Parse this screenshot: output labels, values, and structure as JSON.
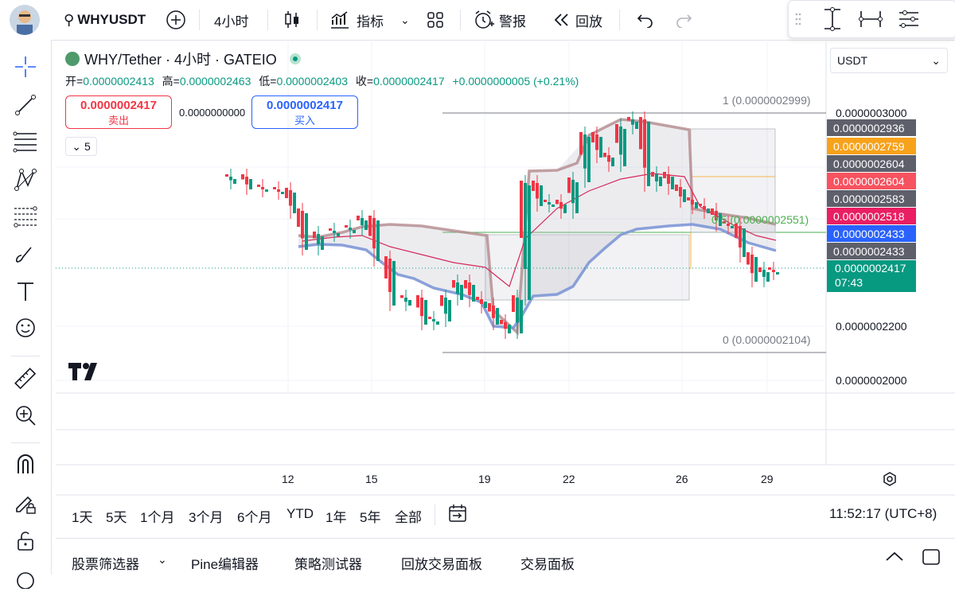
{
  "topbar": {
    "symbol": "WHYUSDT",
    "interval": "4小时",
    "indicators_label": "指标",
    "alert_label": "警报",
    "replay_label": "回放"
  },
  "legend": {
    "title": "WHY/Tether · 4小时 · GATEIO",
    "open_label": "开=",
    "open": "0.0000002413",
    "high_label": "高=",
    "high": "0.0000002463",
    "low_label": "低=",
    "low": "0.0000002403",
    "close_label": "收=",
    "close": "0.0000002417",
    "change": "+0.0000000005 (+0.21%)",
    "sell_price": "0.0000002417",
    "sell_label": "卖出",
    "spread": "0.0000000000",
    "buy_price": "0.0000002417",
    "buy_label": "买入",
    "collapse_count": "5"
  },
  "currency_select": "USDT",
  "fib": {
    "level_1": "1 (0.0000002999)",
    "level_05": "0.5 (0.0000002551)",
    "level_0": "0 (0.0000002104)"
  },
  "price_axis": {
    "ticks": [
      "0.0000003000",
      "0.0000002200",
      "0.0000002000"
    ],
    "tags": [
      {
        "value": "0.0000002936",
        "color": "#5d606b"
      },
      {
        "value": "0.0000002759",
        "color": "#f7a21b"
      },
      {
        "value": "0.0000002604",
        "color": "#5d606b"
      },
      {
        "value": "0.0000002604",
        "color": "#f7525f"
      },
      {
        "value": "0.0000002583",
        "color": "#5d606b"
      },
      {
        "value": "0.0000002518",
        "color": "#e91e63"
      },
      {
        "value": "0.0000002433",
        "color": "#2962ff"
      },
      {
        "value": "0.0000002433",
        "color": "#5d606b"
      }
    ],
    "last_price": "0.0000002417",
    "countdown": "07:43",
    "last_color": "#089981"
  },
  "time_axis": [
    "12",
    "15",
    "19",
    "22",
    "26",
    "29"
  ],
  "ranges": [
    "1天",
    "5天",
    "1个月",
    "3个月",
    "6个月",
    "YTD",
    "1年",
    "5年",
    "全部"
  ],
  "clock": "11:52:17 (UTC+8)",
  "bottom_tabs": [
    "股票筛选器",
    "Pine编辑器",
    "策略测试器",
    "回放交易面板",
    "交易面板"
  ],
  "colors": {
    "up": "#089981",
    "down": "#f23645",
    "accent": "#2962ff"
  }
}
